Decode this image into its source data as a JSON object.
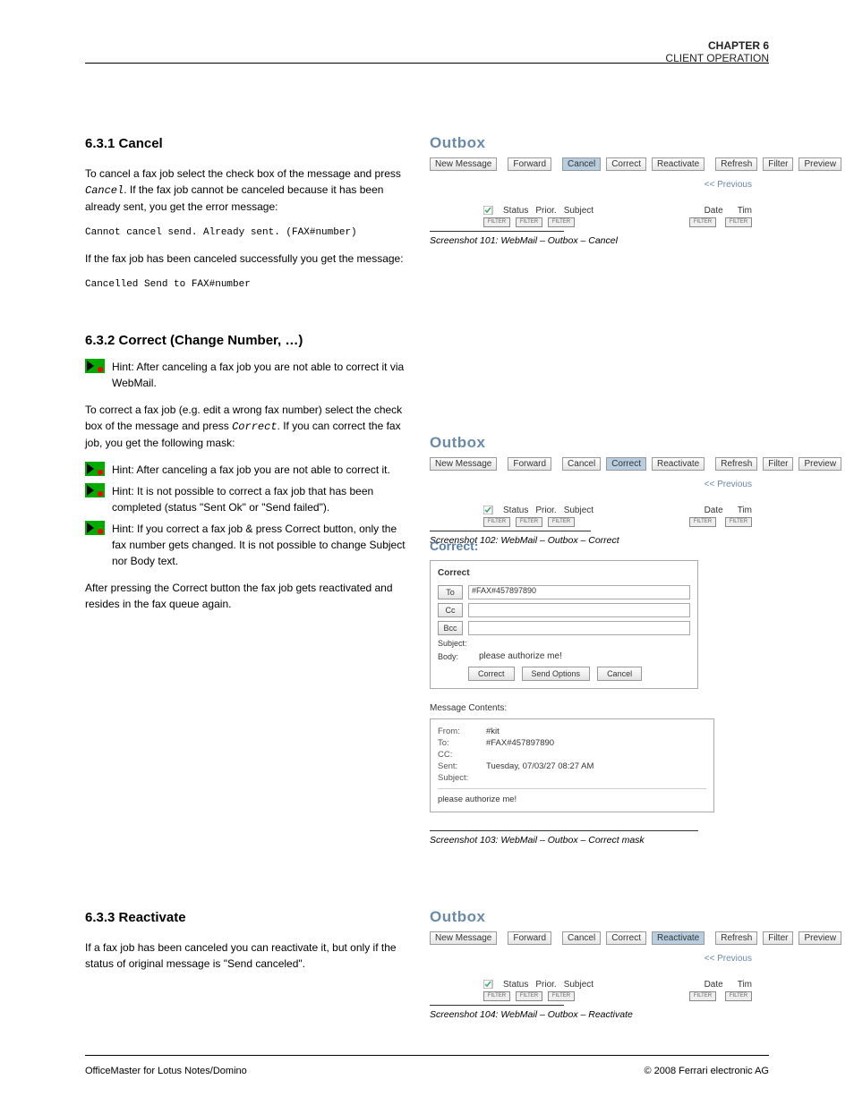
{
  "header": {
    "chapter": "CHAPTER 6",
    "title": "CLIENT OPERATION"
  },
  "cancel": {
    "heading": "6.3.1  Cancel",
    "p1_a": "To cancel a fax job select the check box of the message and press ",
    "p1_b": ". If the fax job cannot be canceled because it has been already sent, you get the error message:",
    "btn": "Cancel",
    "err": "Cannot cancel send. Already sent. (FAX#number)",
    "p2": "If the fax job has been canceled successfully you get the message:",
    "ok": "Cancelled Send to FAX#number"
  },
  "correct": {
    "heading": "6.3.2  Correct (Change Number, …)",
    "hint1": "Hint: After canceling a fax job you are not able to correct it via WebMail.",
    "p1_a": "To correct a fax job (e.g. edit a wrong fax number) select the check box of the message and press ",
    "p1_b": ". If you can correct the fax job, you get the following mask:",
    "btn": "Correct",
    "hint2": "Hint: After canceling a fax job you are not able to correct it.",
    "hint3": "Hint: It is not possible to correct a fax job that has been completed (status \"Sent Ok\" or \"Send failed\").",
    "hint4": "Hint: If you correct a fax job & press Correct button, only the fax number gets changed. It is not possible to change Subject nor Body text.",
    "p2": "After pressing the Correct button the fax job gets reactivated and resides in the fax queue again."
  },
  "reactivate": {
    "heading": "6.3.3  Reactivate",
    "p1": "If a fax job has been canceled you can reactivate it, but only if the status of original message is \"Send canceled\"."
  },
  "outbox": {
    "title": "Outbox",
    "buttons": {
      "new": "New Message",
      "forward": "Forward",
      "cancel": "Cancel",
      "correct": "Correct",
      "reactivate": "Reactivate",
      "refresh": "Refresh",
      "filter": "Filter",
      "preview": "Preview"
    },
    "prev": "<< Previous",
    "cols": {
      "status": "Status",
      "prior": "Prior.",
      "subject": "Subject",
      "date": "Date",
      "time": "Tim"
    },
    "filterLabel": "FILTER"
  },
  "correctForm": {
    "title": "Correct:",
    "boxTitle": "Correct",
    "to": "To",
    "cc": "Cc",
    "bcc": "Bcc",
    "toVal": "#FAX#457897890",
    "subjectLbl": "Subject:",
    "subjectVal": "",
    "bodyLbl": "Body:",
    "bodyVal": "please authorize me!",
    "btnCorrect": "Correct",
    "btnSend": "Send Options",
    "btnCancel": "Cancel"
  },
  "msgContents": {
    "title": "Message Contents:",
    "fromLbl": "From:",
    "from": "#kit",
    "toLbl": "To:",
    "to": "#FAX#457897890",
    "ccLbl": "CC:",
    "cc": "",
    "sentLbl": "Sent:",
    "sent": "Tuesday, 07/03/27 08:27 AM",
    "subjectLbl": "Subject:",
    "subject": "",
    "body": "please authorize me!"
  },
  "captions": {
    "c1": "Screenshot 101: WebMail – Outbox – Cancel",
    "c2": "Screenshot 102: WebMail – Outbox – Correct",
    "c3": "Screenshot 103: WebMail – Outbox – Correct mask",
    "c4": "Screenshot 104: WebMail – Outbox – Reactivate"
  },
  "footer": {
    "left": "OfficeMaster for Lotus Notes/Domino",
    "right": "© 2008 Ferrari electronic AG"
  }
}
